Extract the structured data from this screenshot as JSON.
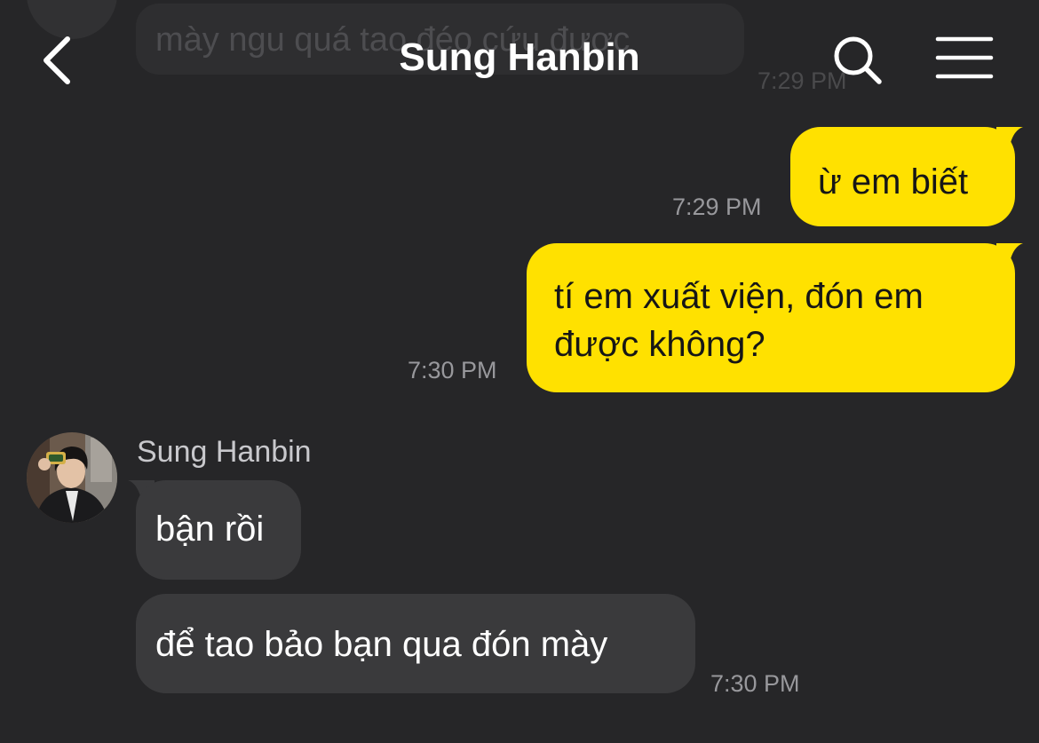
{
  "header": {
    "title": "Sung Hanbin",
    "back_icon": "chevron-left-icon",
    "search_icon": "search-icon",
    "menu_icon": "hamburger-menu-icon"
  },
  "ghost_message": {
    "text": "mày ngu quá tao đéo cứu được",
    "time": "7:29 PM"
  },
  "messages": [
    {
      "direction": "outgoing",
      "text": "ừ em biết",
      "time": "7:29 PM"
    },
    {
      "direction": "outgoing",
      "lines": [
        "tí em xuất viện, đón em",
        "được không?"
      ],
      "time": "7:30 PM"
    },
    {
      "direction": "incoming",
      "sender": "Sung Hanbin",
      "text": "bận rồi"
    },
    {
      "direction": "incoming",
      "text": "để tao bảo bạn qua đón mày",
      "time": "7:30 PM"
    }
  ],
  "colors": {
    "background": "#262628",
    "outgoing_bubble": "#ffe100",
    "incoming_bubble": "#3a3a3c",
    "timestamp": "#98989c"
  }
}
